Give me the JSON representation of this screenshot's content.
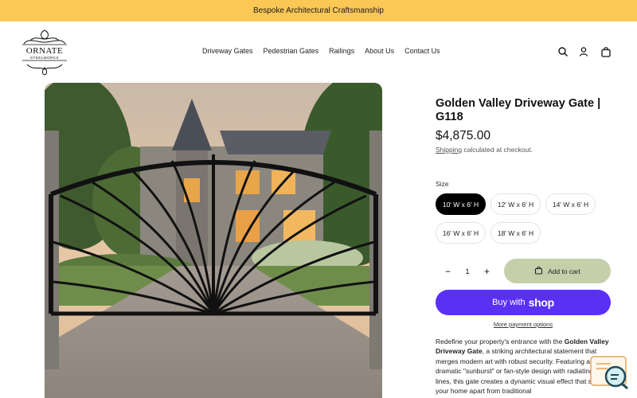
{
  "announcement": "Bespoke Architectural Craftsmanship",
  "brand": {
    "name": "ORNATE",
    "sub": "STEELWORKS"
  },
  "nav": [
    "Driveway Gates",
    "Pedestrian Gates",
    "Railings",
    "About Us",
    "Contact Us"
  ],
  "header_icons": [
    "search-icon",
    "account-icon",
    "cart-icon"
  ],
  "product": {
    "title": "Golden Valley Driveway Gate | G118",
    "price": "$4,875.00",
    "shipping_link": "Shipping",
    "shipping_rest": " calculated at checkout.",
    "size_label": "Size",
    "sizes": [
      "10' W x 6' H",
      "12' W x 6' H",
      "14' W x 6' H",
      "16' W x 6' H",
      "18' W x 6' H"
    ],
    "selected_size": "10' W x 6' H",
    "quantity": "1",
    "qty_minus": "−",
    "qty_plus": "+",
    "add_to_cart": "Add to cart",
    "buy_with": "Buy with",
    "buy_brand": "shop",
    "more_payment": "More payment options",
    "desc_1": "Redefine your property's entrance with the ",
    "desc_bold": "Golden Valley Driveway Gate",
    "desc_2": ", a striking architectural statement that merges modern art with robust security. Featuring a dramatic \"sunburst\" or fan-style design with radiating steel lines, this gate creates a dynamic visual effect that sets your home apart from traditional"
  },
  "colors": {
    "announcement_bg": "#fbc755",
    "shop_pay": "#5a31f4",
    "add_to_cart_bg": "#c5cfaa",
    "selected_pill": "#000000"
  }
}
